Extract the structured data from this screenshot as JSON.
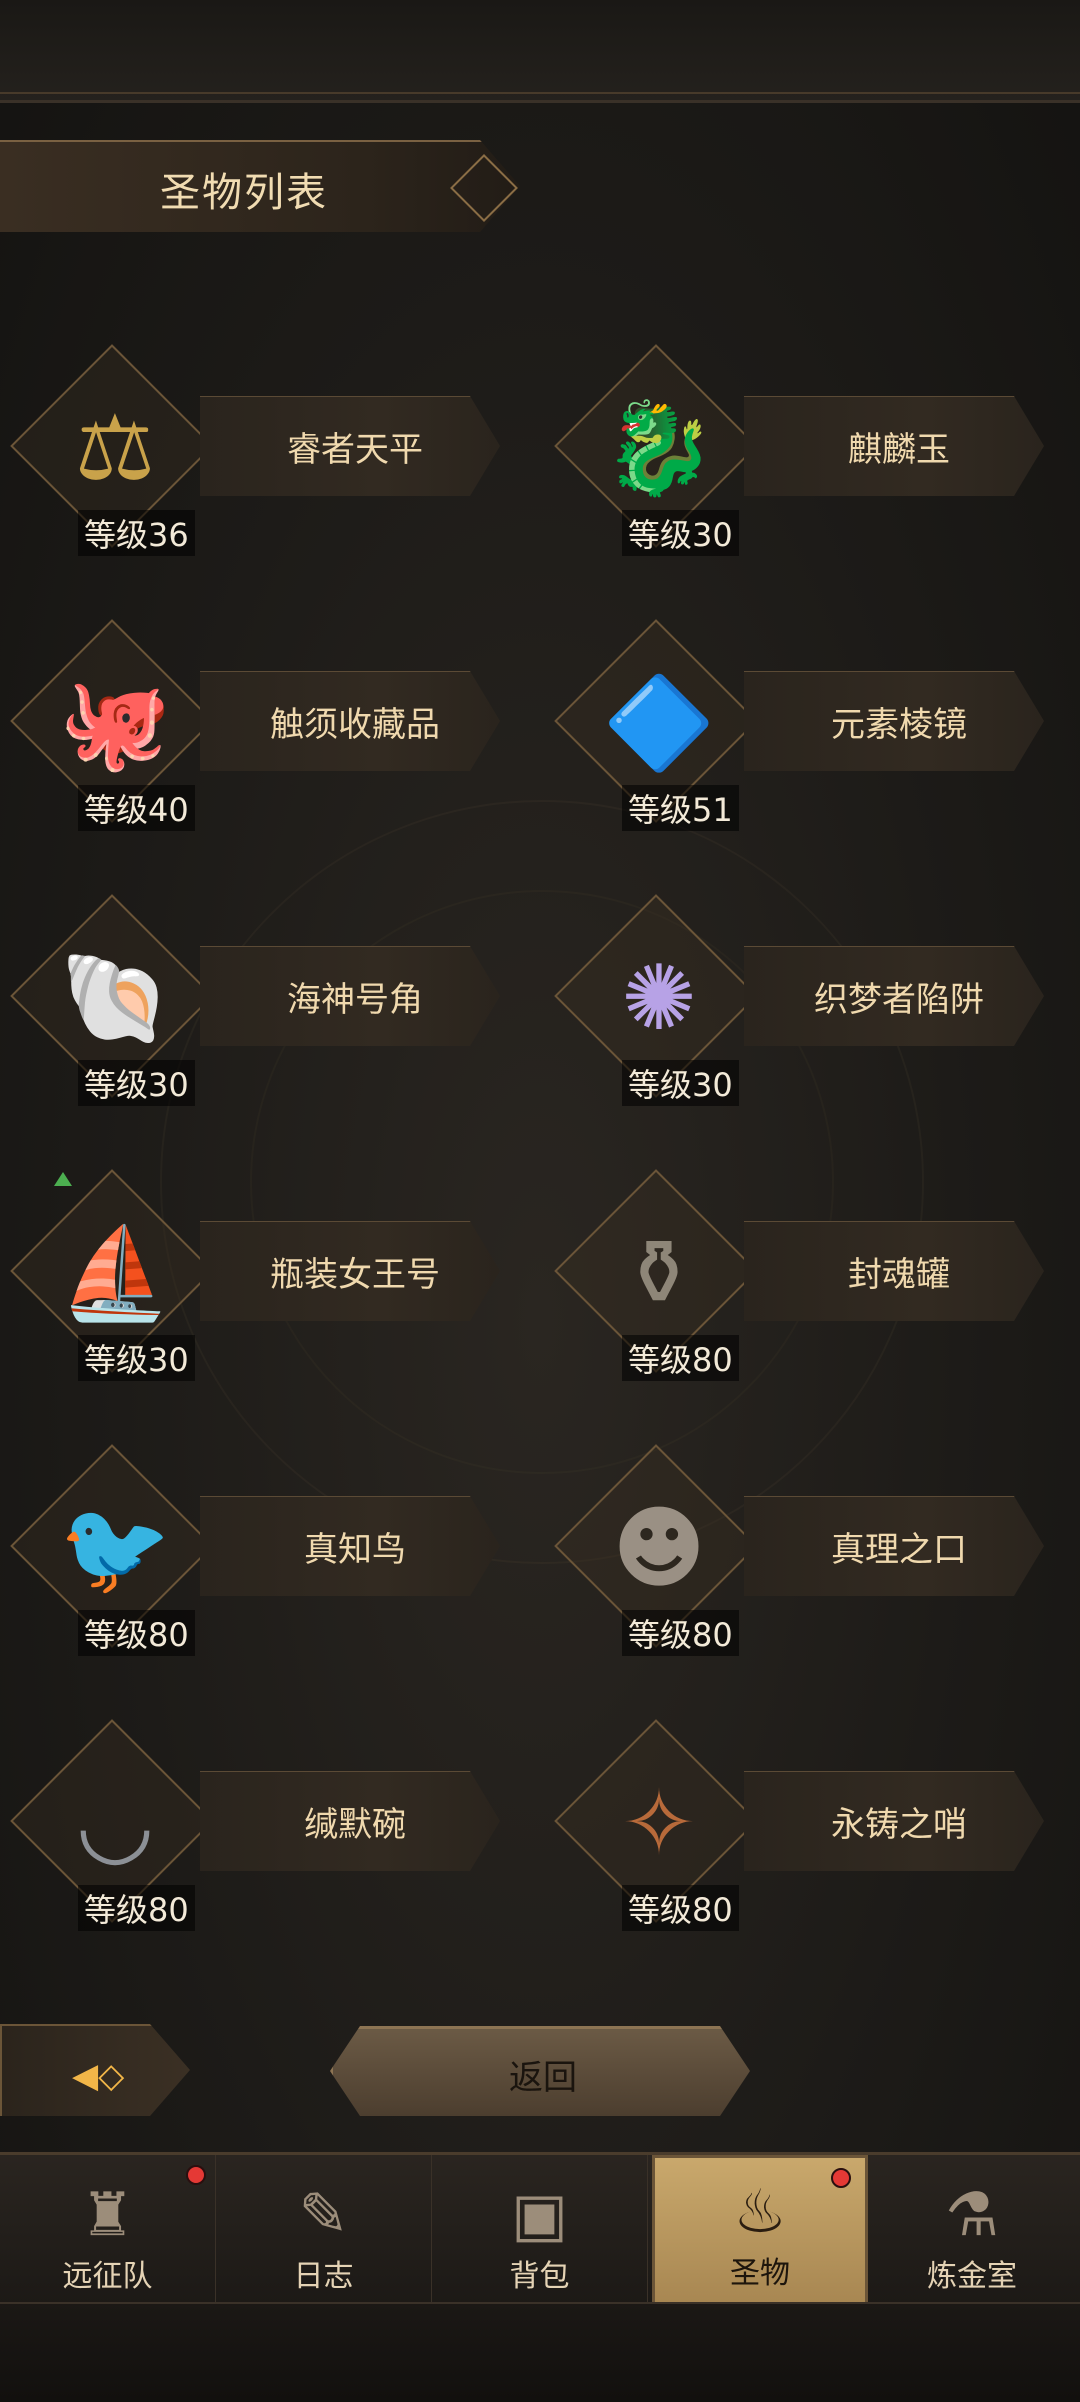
{
  "header": {
    "title": "圣物列表"
  },
  "relics": [
    {
      "name": "睿者天平",
      "level": "等级36",
      "icon": "scale-icon",
      "glyph": "⚖",
      "color": "#c9a24a"
    },
    {
      "name": "麒麟玉",
      "level": "等级30",
      "icon": "jade-dragon-icon",
      "glyph": "🐉",
      "color": "#3f8f6e"
    },
    {
      "name": "触须收藏品",
      "level": "等级40",
      "icon": "tentacle-icon",
      "glyph": "🐙",
      "color": "#2f6e66"
    },
    {
      "name": "元素棱镜",
      "level": "等级51",
      "icon": "prism-icon",
      "glyph": "🔷",
      "color": "#7fb6e6"
    },
    {
      "name": "海神号角",
      "level": "等级30",
      "icon": "conch-icon",
      "glyph": "🐚",
      "color": "#d8c6a8"
    },
    {
      "name": "织梦者陷阱",
      "level": "等级30",
      "icon": "dreamcatcher-icon",
      "glyph": "✺",
      "color": "#b7a2e6"
    },
    {
      "name": "瓶装女王号",
      "level": "等级30",
      "icon": "ship-bottle-icon",
      "glyph": "⛵",
      "color": "#b8a88a"
    },
    {
      "name": "封魂罐",
      "level": "等级80",
      "icon": "soul-jar-icon",
      "glyph": "⚱",
      "color": "#8e8678"
    },
    {
      "name": "真知鸟",
      "level": "等级80",
      "icon": "bird-icon",
      "glyph": "🐦",
      "color": "#8a8a86"
    },
    {
      "name": "真理之口",
      "level": "等级80",
      "icon": "stone-face-icon",
      "glyph": "☻",
      "color": "#9a9084"
    },
    {
      "name": "缄默碗",
      "level": "等级80",
      "icon": "bowl-icon",
      "glyph": "◡",
      "color": "#8c9096"
    },
    {
      "name": "永铸之哨",
      "level": "等级80",
      "icon": "whistle-icon",
      "glyph": "✧",
      "color": "#b86a3a"
    }
  ],
  "buttons": {
    "return_label": "返回"
  },
  "tabs": [
    {
      "label": "远征队",
      "icon": "helmet-icon",
      "glyph": "♜",
      "badge": true
    },
    {
      "label": "日志",
      "icon": "scroll-icon",
      "glyph": "✎",
      "badge": false
    },
    {
      "label": "背包",
      "icon": "backpack-icon",
      "glyph": "▣",
      "badge": false
    },
    {
      "label": "圣物",
      "icon": "torch-icon",
      "glyph": "♨",
      "badge": true,
      "active": true
    },
    {
      "label": "炼金室",
      "icon": "alchemy-icon",
      "glyph": "⚗",
      "badge": false
    }
  ]
}
